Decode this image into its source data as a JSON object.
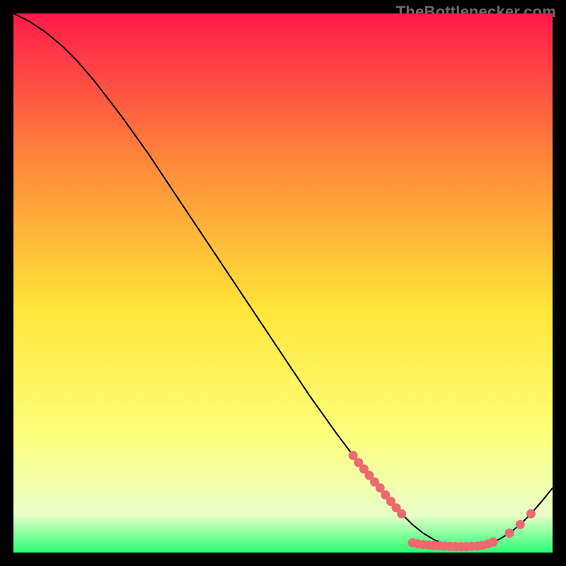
{
  "watermark": "TheBottlenecker.com",
  "colors": {
    "frame": "#000000",
    "curve": "#000000",
    "marker_fill": "#ec6a6f",
    "marker_stroke": "#d24a50",
    "grad_top": "#ff1a4b",
    "grad_mid_upper": "#ff8a3a",
    "grad_mid": "#ffe63a",
    "grad_mid_lower": "#fdff7a",
    "grad_low": "#e8ffc8",
    "grad_bottom": "#2bff77"
  },
  "chart_data": {
    "type": "line",
    "title": "",
    "xlabel": "",
    "ylabel": "",
    "xlim": [
      0,
      100
    ],
    "ylim": [
      0,
      100
    ],
    "series": [
      {
        "name": "curve",
        "x": [
          0,
          3,
          6,
          9,
          12,
          15,
          20,
          25,
          30,
          35,
          40,
          45,
          50,
          55,
          60,
          63,
          65,
          68,
          70,
          72,
          74,
          76,
          78,
          80,
          82,
          84,
          86,
          88,
          90,
          92,
          94,
          96,
          98,
          100
        ],
        "y": [
          100,
          98.5,
          96.5,
          94,
          91,
          87.5,
          81,
          74,
          66.5,
          59,
          51.5,
          44,
          36.5,
          29,
          22,
          18,
          15.5,
          12,
          9.5,
          7.2,
          5.2,
          3.6,
          2.4,
          1.6,
          1.2,
          1.1,
          1.2,
          1.6,
          2.4,
          3.6,
          5.2,
          7.2,
          9.5,
          12
        ]
      }
    ],
    "markers": {
      "name": "highlight-band",
      "points": [
        {
          "x": 63,
          "y": 18.0
        },
        {
          "x": 64,
          "y": 16.7
        },
        {
          "x": 65,
          "y": 15.5
        },
        {
          "x": 66,
          "y": 14.3
        },
        {
          "x": 67,
          "y": 13.1
        },
        {
          "x": 68,
          "y": 12.0
        },
        {
          "x": 69,
          "y": 10.7
        },
        {
          "x": 70,
          "y": 9.5
        },
        {
          "x": 71,
          "y": 8.3
        },
        {
          "x": 72,
          "y": 7.2
        },
        {
          "x": 74,
          "y": 1.8
        },
        {
          "x": 75,
          "y": 1.6
        },
        {
          "x": 76,
          "y": 1.5
        },
        {
          "x": 77,
          "y": 1.4
        },
        {
          "x": 78,
          "y": 1.3
        },
        {
          "x": 79,
          "y": 1.25
        },
        {
          "x": 80,
          "y": 1.2
        },
        {
          "x": 81,
          "y": 1.15
        },
        {
          "x": 82,
          "y": 1.12
        },
        {
          "x": 83,
          "y": 1.1
        },
        {
          "x": 84,
          "y": 1.1
        },
        {
          "x": 85,
          "y": 1.15
        },
        {
          "x": 86,
          "y": 1.2
        },
        {
          "x": 87,
          "y": 1.35
        },
        {
          "x": 88,
          "y": 1.6
        },
        {
          "x": 89,
          "y": 1.95
        },
        {
          "x": 92,
          "y": 3.6
        },
        {
          "x": 94,
          "y": 5.2
        },
        {
          "x": 96,
          "y": 7.2
        }
      ]
    }
  }
}
